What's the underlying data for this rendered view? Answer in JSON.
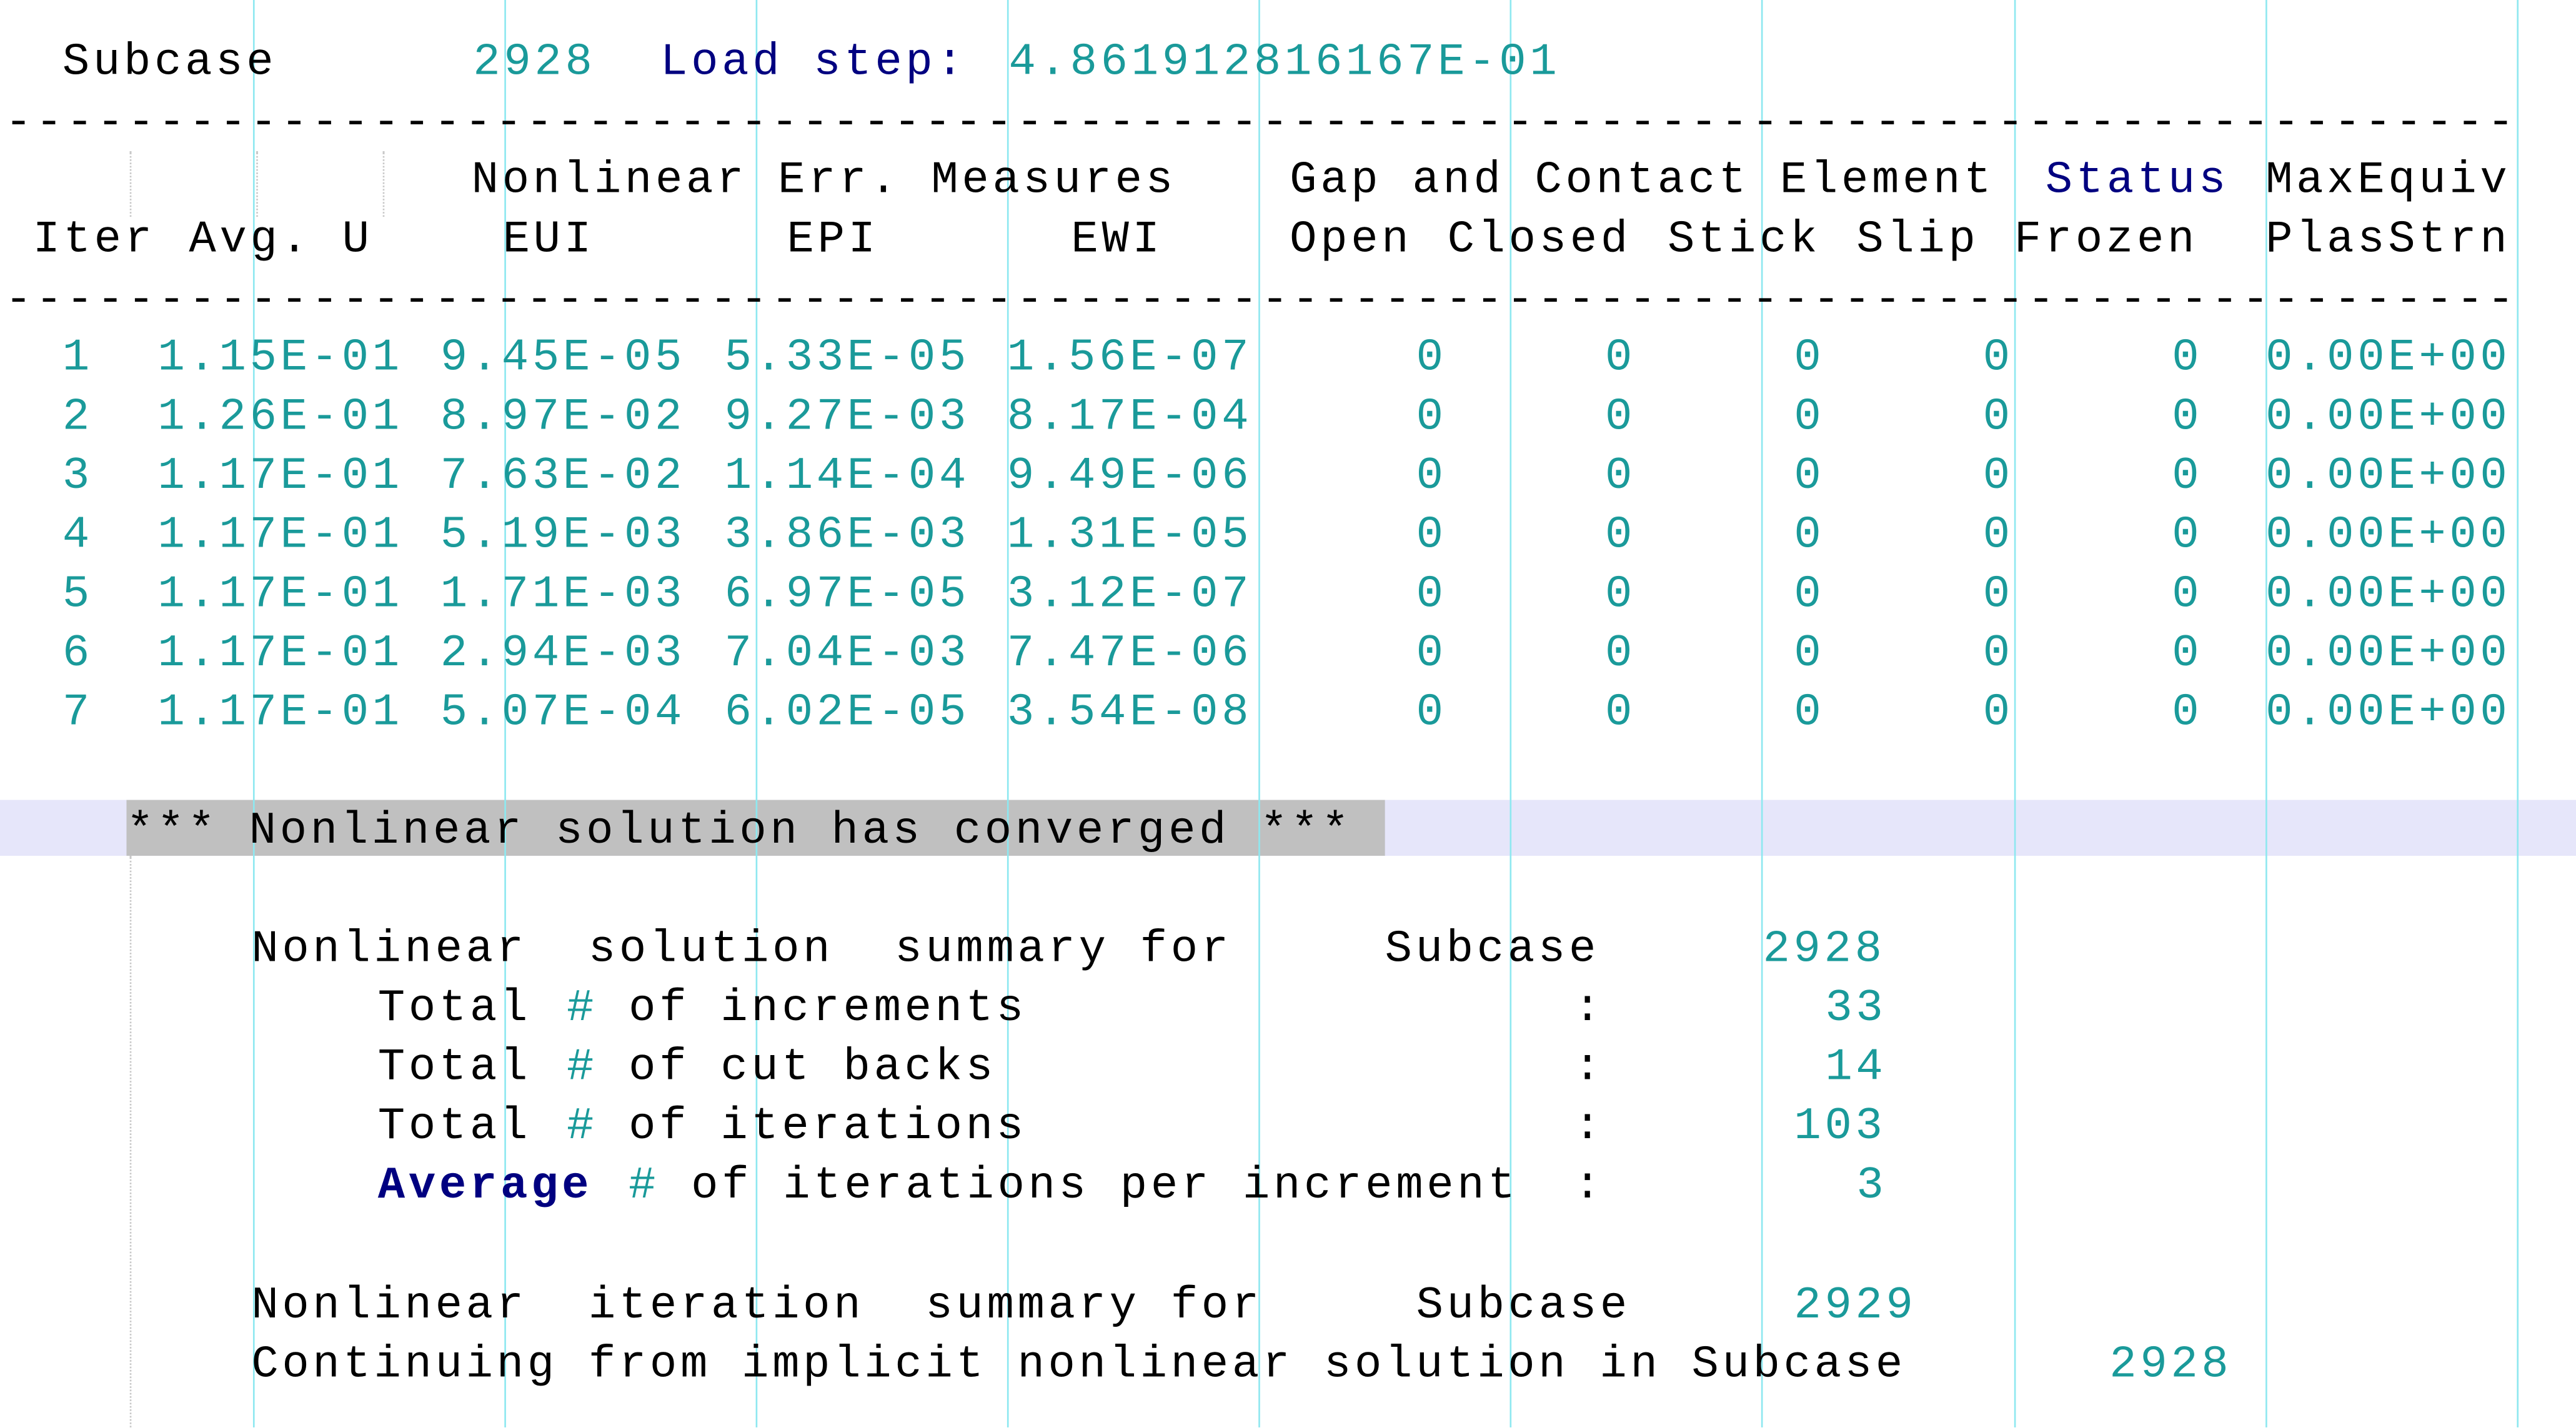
{
  "header": {
    "subcase_label": "Subcase",
    "subcase_value": "2928",
    "load_step_label": "Load step:",
    "load_step_value": "4.861912816167E-01"
  },
  "separator": "---------------------------------------------------------------------------------------------------------",
  "table": {
    "group_headers": {
      "nonlinear": "Nonlinear Err. Measures",
      "gap_contact": "Gap and Contact Element",
      "status": "Status",
      "max_equiv": "MaxEquiv"
    },
    "columns": [
      "Iter",
      "Avg. U",
      "EUI",
      "EPI",
      "EWI",
      "Open",
      "Closed",
      "Stick",
      "Slip",
      "Frozen",
      "PlasStrn"
    ],
    "rows": [
      [
        "1",
        "1.15E-01",
        "9.45E-05",
        "5.33E-05",
        "1.56E-07",
        "0",
        "0",
        "0",
        "0",
        "0",
        "0.00E+00"
      ],
      [
        "2",
        "1.26E-01",
        "8.97E-02",
        "9.27E-03",
        "8.17E-04",
        "0",
        "0",
        "0",
        "0",
        "0",
        "0.00E+00"
      ],
      [
        "3",
        "1.17E-01",
        "7.63E-02",
        "1.14E-04",
        "9.49E-06",
        "0",
        "0",
        "0",
        "0",
        "0",
        "0.00E+00"
      ],
      [
        "4",
        "1.17E-01",
        "5.19E-03",
        "3.86E-03",
        "1.31E-05",
        "0",
        "0",
        "0",
        "0",
        "0",
        "0.00E+00"
      ],
      [
        "5",
        "1.17E-01",
        "1.71E-03",
        "6.97E-05",
        "3.12E-07",
        "0",
        "0",
        "0",
        "0",
        "0",
        "0.00E+00"
      ],
      [
        "6",
        "1.17E-01",
        "2.94E-03",
        "7.04E-03",
        "7.47E-06",
        "0",
        "0",
        "0",
        "0",
        "0",
        "0.00E+00"
      ],
      [
        "7",
        "1.17E-01",
        "5.07E-04",
        "6.02E-05",
        "3.54E-08",
        "0",
        "0",
        "0",
        "0",
        "0",
        "0.00E+00"
      ]
    ]
  },
  "converged_message": "*** Nonlinear solution has converged ***",
  "summary": {
    "title": "Nonlinear  solution  summary for",
    "subcase_label": "Subcase",
    "subcase_value": "2928",
    "lines": [
      {
        "pre": "Total ",
        "hash": "#",
        "post": " of increments",
        "value": "33"
      },
      {
        "pre": "Total ",
        "hash": "#",
        "post": " of cut backs",
        "value": "14"
      },
      {
        "pre": "Total ",
        "hash": "#",
        "post": " of iterations",
        "value": "103"
      },
      {
        "pre": "Average",
        "hash": " #",
        "post": " of iterations per increment",
        "value": "3"
      }
    ],
    "colon": ":"
  },
  "iteration_summary": {
    "title": "Nonlinear  iteration  summary for",
    "subcase_label": "Subcase",
    "subcase_value": "2929"
  },
  "continuing": {
    "text": "Continuing from implicit nonlinear solution in Subcase",
    "value": "2928"
  },
  "colors": {
    "teal": "#1a9a9a",
    "navy": "#000080",
    "guide": "#8ee8f0",
    "highlight_band": "#e6e6fa",
    "selection": "#c0c0c0"
  }
}
